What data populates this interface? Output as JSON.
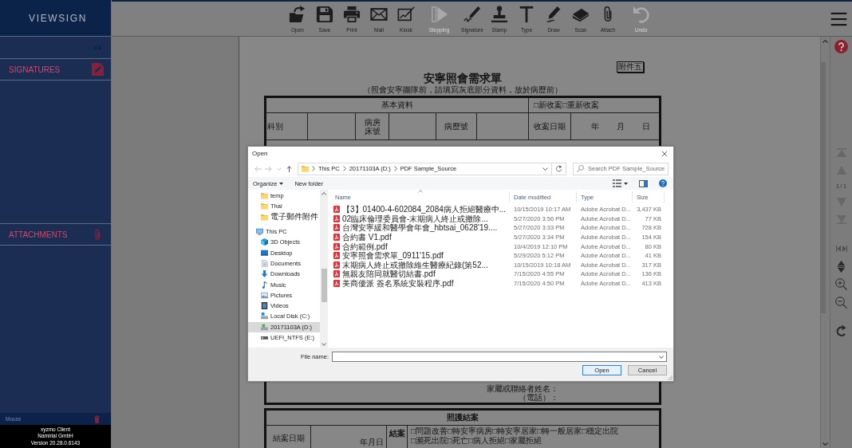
{
  "sidebar": {
    "logo": "VIEWSIGN",
    "panels": [
      {
        "title": "SIGNATURES"
      },
      {
        "title": "ATTACHMENTS"
      }
    ],
    "input_mode": "Mouse",
    "footer": [
      "xyzmo Client",
      "Namirial GmbH",
      "Version 20.28.0.6143"
    ]
  },
  "toolbar": {
    "groups": [
      [
        {
          "label": "Open",
          "disabled": false
        },
        {
          "label": "Save",
          "disabled": false
        },
        {
          "label": "Print",
          "disabled": false
        },
        {
          "label": "Mail",
          "disabled": false
        },
        {
          "label": "Kiosk",
          "disabled": false
        }
      ],
      [
        {
          "label": "Stepping",
          "disabled": true
        }
      ],
      [
        {
          "label": "Signature",
          "disabled": false
        },
        {
          "label": "Stamp",
          "disabled": false
        },
        {
          "label": "Type",
          "disabled": false
        },
        {
          "label": "Draw",
          "disabled": false
        },
        {
          "label": "Scan",
          "disabled": false
        },
        {
          "label": "Attach",
          "disabled": false
        }
      ],
      [
        {
          "label": "Undo",
          "disabled": true
        }
      ]
    ]
  },
  "document": {
    "annex_label": "附件五",
    "title": "安寧照會需求單",
    "subtitle": "（照會安寧團隊前，請填寫灰底部分資料，放於病歷前）",
    "basic_info": {
      "heading": "基本資料",
      "case_type": "□新收案□重新收案",
      "fields": [
        "科別",
        "病房床號",
        "病歷號",
        "收案日期"
      ],
      "date_units": [
        "年",
        "月",
        "日"
      ]
    },
    "contact": [
      "家屬或聯絡者姓名：",
      "（電話）："
    ],
    "closure": {
      "heading": "照護結案",
      "date_label": "結案日期",
      "date_units": "年月日",
      "reason_label": "結案",
      "options": [
        "□問題改善□轉安寧病房□轉安寧居家□轉一般居家□穩定出院",
        "□瀕死出院□死亡□病人拒絕□家屬拒絕"
      ]
    }
  },
  "side_panel": {
    "page_indicator": "1 / 1"
  },
  "dialog": {
    "title": "Open",
    "path": [
      "This PC",
      "20171103A (D:)",
      "PDF Sample_Source"
    ],
    "search": {
      "placeholder": "Search PDF Sample_Source"
    },
    "commands": [
      {
        "label": "Organize",
        "menu": true
      },
      {
        "label": "New folder",
        "menu": false
      }
    ],
    "navigation": [
      {
        "children": [
          {
            "label": "temp",
            "kind": "folder",
            "selected": false
          },
          {
            "label": "Thai",
            "kind": "folder",
            "selected": false
          },
          {
            "label": "電子郵件附件",
            "kind": "folder",
            "selected": false
          }
        ]
      },
      {
        "label": "This PC",
        "kind": "computer",
        "selected": false,
        "children": [
          {
            "label": "3D Objects",
            "kind": "objects",
            "selected": false
          },
          {
            "label": "Desktop",
            "kind": "desktop",
            "selected": false
          },
          {
            "label": "Documents",
            "kind": "documents",
            "selected": false
          },
          {
            "label": "Downloads",
            "kind": "downloads",
            "selected": false
          },
          {
            "label": "Music",
            "kind": "music",
            "selected": false
          },
          {
            "label": "Pictures",
            "kind": "pictures",
            "selected": false
          },
          {
            "label": "Videos",
            "kind": "videos",
            "selected": false
          },
          {
            "label": "Local Disk (C:)",
            "kind": "systemdisk",
            "selected": false
          },
          {
            "label": "20171103A (D:)",
            "kind": "disk",
            "selected": true
          },
          {
            "label": "UEFI_NTFS (E:)",
            "kind": "usb",
            "selected": false
          }
        ]
      }
    ],
    "columns": [
      {
        "label": "Name",
        "sorted": true
      },
      {
        "label": "Date modified",
        "sorted": false
      },
      {
        "label": "Type",
        "sorted": false
      },
      {
        "label": "Size",
        "sorted": false
      }
    ],
    "files": [
      {
        "name": "【3】01400-4-602084_2084病人拒絕醫療中...",
        "date": "10/15/2019 10:17 AM",
        "type": "Adobe Acrobat D...",
        "size": "3,437 KB"
      },
      {
        "name": "02臨床倫理委員會-末期病人終止或撤除...",
        "date": "5/27/2020 3:56 PM",
        "type": "Adobe Acrobat D...",
        "size": "77 KB"
      },
      {
        "name": "台灣安寧緩和醫學會年會_hbtsai_0628'19....",
        "date": "5/27/2020 3:33 PM",
        "type": "Adobe Acrobat D...",
        "size": "728 KB"
      },
      {
        "name": "合約書 V1.pdf",
        "date": "5/27/2020 3:34 PM",
        "type": "Adobe Acrobat D...",
        "size": "154 KB"
      },
      {
        "name": "合約範例.pdf",
        "date": "10/4/2019 12:10 PM",
        "type": "Adobe Acrobat D...",
        "size": "80 KB"
      },
      {
        "name": "安寧照會需求單_0911'15.pdf",
        "date": "5/29/2020 5:12 PM",
        "type": "Adobe Acrobat D...",
        "size": "41 KB"
      },
      {
        "name": "末期病人終止或撤除維生醫療紀錄(第52...",
        "date": "10/15/2019 10:18 AM",
        "type": "Adobe Acrobat D...",
        "size": "317 KB"
      },
      {
        "name": "無親友陪同就醫切結書.pdf",
        "date": "7/15/2020 4:55 PM",
        "type": "Adobe Acrobat D...",
        "size": "136 KB"
      },
      {
        "name": "美商優派 簽名系統安裝程序.pdf",
        "date": "7/15/2020 4:50 PM",
        "type": "Adobe Acrobat D...",
        "size": "413 KB"
      }
    ],
    "file_name": {
      "label": "File name:"
    },
    "buttons": [
      {
        "label": "Open",
        "default": true
      },
      {
        "label": "Cancel",
        "default": false
      }
    ]
  }
}
